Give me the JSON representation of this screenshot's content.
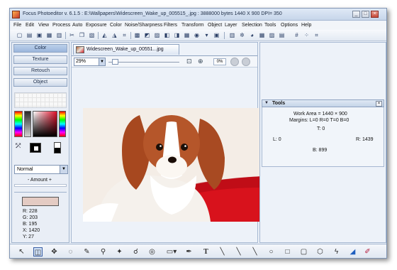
{
  "window": {
    "title": "Focus Photoeditor v. 6.1.5 : E:\\Wallpapers\\Widescreen_Wake_up_005515_.jpg : 3888000 bytes    1440 X 900 DPI= 350",
    "controls": [
      "_",
      "□",
      "×"
    ]
  },
  "menu": [
    "File",
    "Edit",
    "View",
    "Process",
    "Auto",
    "Exposure",
    "Color",
    "Noise/Sharpness",
    "Filters",
    "Transform",
    "Object",
    "Layer",
    "Selection",
    "Tools",
    "Options",
    "Help"
  ],
  "toolbar_icons": [
    "new-icon",
    "open-icon",
    "save-icon",
    "print-icon",
    "scanner-icon",
    "cut-icon",
    "copy-icon",
    "paste-icon",
    "undo-icon",
    "redo-icon",
    "crop-icon",
    "resize-icon",
    "rotate-icon",
    "levels-icon",
    "curves-icon",
    "hue-icon",
    "effects-icon",
    "text-icon",
    "brush-icon",
    "grid-icon",
    "zoom-icon",
    "color-wheel-icon",
    "usm-icon",
    "hash-icon",
    "sparkle-icon",
    "layers-icon"
  ],
  "left_panel": {
    "tabs": [
      "Color",
      "Texture",
      "Retouch",
      "Object"
    ],
    "active_tab": "Color",
    "blend_mode": "Normal",
    "amount_label": "- Amount +",
    "preview_color": "#e4cbc3",
    "readout": {
      "r": "R: 228",
      "g": "G: 203",
      "b": "B: 195",
      "x": "X: 1420",
      "y": "Y: 27"
    }
  },
  "document": {
    "tab_label": "Widescreen_Wake_up_00551...jpg",
    "zoom": "29%",
    "rotation": "0%",
    "zoom_level": 0.05
  },
  "tools_panel": {
    "title": "Tools",
    "close": "×",
    "work_area": "Work Area = 1440 × 900",
    "margins": "Margins: L=0 R=0 T=0 B=0",
    "t": "T: 0",
    "l": "L: 0",
    "r": "R: 1439",
    "b": "B: 899"
  },
  "bottom_tools": [
    "pointer-icon",
    "select-rect-icon",
    "move-icon",
    "lasso-icon",
    "magic-wand-icon",
    "clone-icon",
    "retouch-icon",
    "blur-icon",
    "eraser-icon",
    "selection-dropdown-icon",
    "eyedropper-icon",
    "text-tool-icon",
    "line-icon",
    "arrow-line-icon",
    "curve-icon",
    "ellipse-icon",
    "rectangle-icon",
    "rounded-rect-icon",
    "polygon-icon",
    "freehand-icon",
    "fill-icon",
    "paint-icon"
  ],
  "colors": {
    "accent": "#3a5ea3",
    "panel": "#ecf1f8"
  }
}
